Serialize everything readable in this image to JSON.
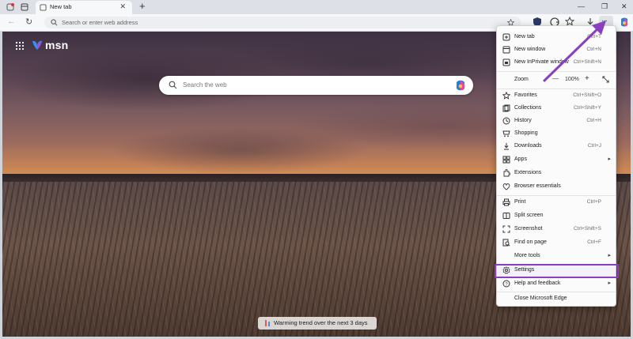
{
  "browser": {
    "tab_title": "New tab",
    "address_placeholder": "Search or enter web address"
  },
  "msn": {
    "logo_text": "msn",
    "search_placeholder": "Search the web",
    "weather_text": "Warming trend over the next 3 days"
  },
  "menu": {
    "items": [
      {
        "label": "New tab",
        "shortcut": "Ctrl+T",
        "icon": "new-tab-icon"
      },
      {
        "label": "New window",
        "shortcut": "Ctrl+N",
        "icon": "new-window-icon"
      },
      {
        "label": "New InPrivate window",
        "shortcut": "Ctrl+Shift+N",
        "icon": "inprivate-icon"
      },
      {
        "label": "Zoom",
        "value": "100%"
      },
      {
        "label": "Favorites",
        "shortcut": "Ctrl+Shift+O",
        "icon": "star-icon"
      },
      {
        "label": "Collections",
        "shortcut": "Ctrl+Shift+Y",
        "icon": "collections-icon"
      },
      {
        "label": "History",
        "shortcut": "Ctrl+H",
        "icon": "history-icon"
      },
      {
        "label": "Shopping",
        "shortcut": "",
        "icon": "shopping-icon"
      },
      {
        "label": "Downloads",
        "shortcut": "Ctrl+J",
        "icon": "download-icon"
      },
      {
        "label": "Apps",
        "shortcut": "",
        "icon": "apps-icon"
      },
      {
        "label": "Extensions",
        "shortcut": "",
        "icon": "extensions-icon"
      },
      {
        "label": "Browser essentials",
        "shortcut": "",
        "icon": "heart-icon"
      },
      {
        "label": "Print",
        "shortcut": "Ctrl+P",
        "icon": "print-icon"
      },
      {
        "label": "Split screen",
        "shortcut": "",
        "icon": "split-screen-icon"
      },
      {
        "label": "Screenshot",
        "shortcut": "Ctrl+Shift+S",
        "icon": "screenshot-icon"
      },
      {
        "label": "Find on page",
        "shortcut": "Ctrl+F",
        "icon": "find-icon"
      },
      {
        "label": "More tools",
        "shortcut": "",
        "icon": ""
      },
      {
        "label": "Settings",
        "shortcut": "",
        "icon": "gear-icon"
      },
      {
        "label": "Help and feedback",
        "shortcut": "",
        "icon": "help-icon"
      },
      {
        "label": "Close Microsoft Edge",
        "shortcut": "",
        "icon": ""
      }
    ]
  },
  "colors": {
    "highlight": "#8a3fbf",
    "arrow": "#8a3fbf"
  }
}
